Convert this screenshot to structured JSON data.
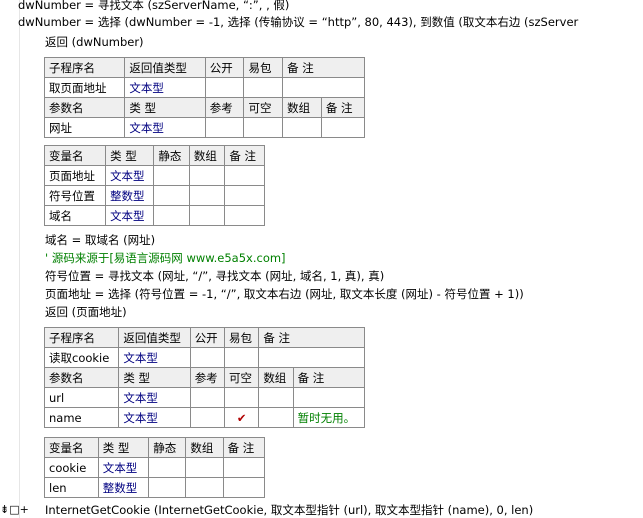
{
  "code_lines": {
    "l1": "dwNumber = 寻找文本 (szServerName, “:”, , 假)",
    "l2": "dwNumber = 选择 (dwNumber = -1, 选择 (传输协议 = “http”, 80, 443), 到数值 (取文本右边 (szServer",
    "l3": "返回 (dwNumber)",
    "l4": "域名 = 取域名 (网址)",
    "l5": "' 源码来源于[易语言源码网 www.e5a5x.com]",
    "l6": "符号位置 = 寻找文本 (网址, “/”, 寻找文本 (网址, 域名, 1, 真), 真)",
    "l7": "页面地址 = 选择 (符号位置 = -1, “/”, 取文本右边 (网址, 取文本长度 (网址) - 符号位置 + 1))",
    "l8": "返回 (页面地址)",
    "l9": "InternetGetCookie (InternetGetCookie, 取文本型指针 (url), 取文本型指针 (name), 0, len)"
  },
  "gutter_marker": "⇟□+",
  "sub1": {
    "headers": [
      "子程序名",
      "返回值类型",
      "公开",
      "易包",
      "备 注"
    ],
    "row": [
      "取页面地址",
      "文本型",
      "",
      "",
      ""
    ],
    "param_headers": [
      "参数名",
      "类 型",
      "参考",
      "可空",
      "数组",
      "备 注"
    ],
    "params": [
      [
        "网址",
        "文本型",
        "",
        "",
        "",
        ""
      ]
    ]
  },
  "vars1": {
    "headers": [
      "变量名",
      "类 型",
      "静态",
      "数组",
      "备 注"
    ],
    "rows": [
      [
        "页面地址",
        "文本型",
        "",
        "",
        ""
      ],
      [
        "符号位置",
        "整数型",
        "",
        "",
        ""
      ],
      [
        "域名",
        "文本型",
        "",
        "",
        ""
      ]
    ]
  },
  "sub2": {
    "headers": [
      "子程序名",
      "返回值类型",
      "公开",
      "易包",
      "备 注"
    ],
    "row": [
      "读取cookie",
      "文本型",
      "",
      "",
      ""
    ],
    "param_headers": [
      "参数名",
      "类 型",
      "参考",
      "可空",
      "数组",
      "备 注"
    ],
    "params": [
      [
        "url",
        "文本型",
        "",
        "",
        "",
        ""
      ],
      [
        "name",
        "文本型",
        "",
        "✔",
        "",
        "暂时无用。"
      ]
    ]
  },
  "vars2": {
    "headers": [
      "变量名",
      "类 型",
      "静态",
      "数组",
      "备 注"
    ],
    "rows": [
      [
        "cookie",
        "文本型",
        "",
        "",
        ""
      ],
      [
        "len",
        "整数型",
        "",
        "",
        ""
      ]
    ]
  }
}
